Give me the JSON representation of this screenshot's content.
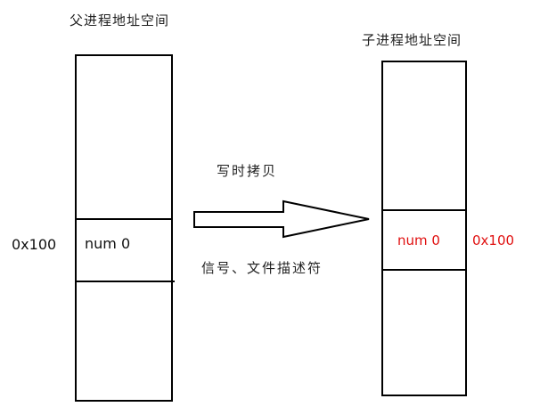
{
  "parent": {
    "title": "父进程地址空间",
    "address": "0x100",
    "cell_text": "num 0"
  },
  "child": {
    "title": "子进程地址空间",
    "address": "0x100",
    "cell_text": "num 0",
    "highlight_color": "#e01010"
  },
  "arrow": {
    "top_caption": "写时拷贝",
    "bottom_caption": "信号、文件描述符"
  }
}
